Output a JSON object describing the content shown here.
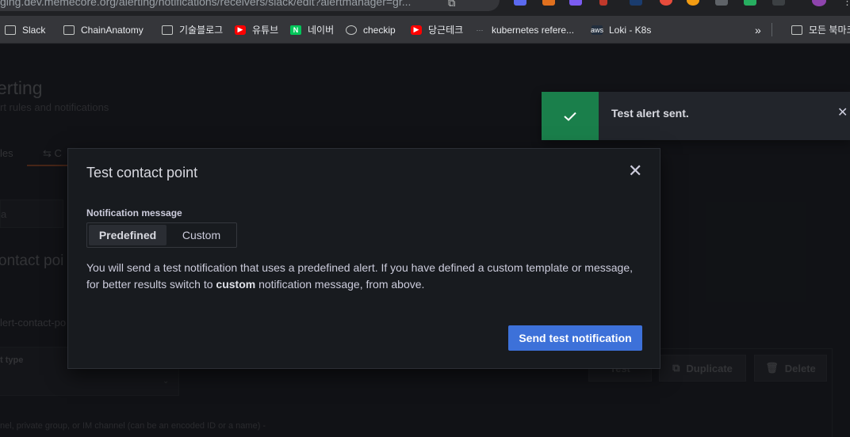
{
  "browser": {
    "url": "ging.dev.memecore.org/alerting/notifications/receivers/slack/edit?alertmanager=gr...",
    "bookmarks": [
      {
        "label": "Slack",
        "icon": "folder-icon"
      },
      {
        "label": "ChainAnatomy",
        "icon": "folder-icon"
      },
      {
        "label": "기술블로그",
        "icon": "folder-icon"
      },
      {
        "label": "유튜브",
        "icon": "youtube-icon"
      },
      {
        "label": "네이버",
        "icon": "naver-icon"
      },
      {
        "label": "checkip",
        "icon": "globe-icon"
      },
      {
        "label": "당근테크",
        "icon": "youtube-icon"
      },
      {
        "label": "kubernetes refere...",
        "icon": "kubernetes-icon"
      },
      {
        "label": "Loki - K8s",
        "icon": "aws-icon"
      }
    ],
    "more_label": "»",
    "all_bookmarks_label": "모든 북마크"
  },
  "background": {
    "title": "erting",
    "subtitle": "rt rules and notifications",
    "tab_rules": "les",
    "tab_contact": "C",
    "search_placeholder": "a",
    "section_title": "ontact poi",
    "name_value": "lert-contact-po",
    "integration_label": "t type",
    "help_text": "nel, private group, or IM channel (can be an encoded ID or a name) -",
    "test_label": "Test",
    "duplicate_label": "Duplicate",
    "delete_label": "Delete"
  },
  "toast": {
    "message": "Test alert sent.",
    "status_color": "#1a7f4b"
  },
  "modal": {
    "title": "Test contact point",
    "field_label": "Notification message",
    "options": [
      "Predefined",
      "Custom"
    ],
    "selected_option": "Predefined",
    "description_part1": "You will send a test notification that uses a predefined alert. If you have defined a custom template or message, for better results switch to ",
    "description_bold": "custom",
    "description_part2": " notification message, from above.",
    "send_button": "Send test notification",
    "accent_color": "#3d71d9"
  }
}
